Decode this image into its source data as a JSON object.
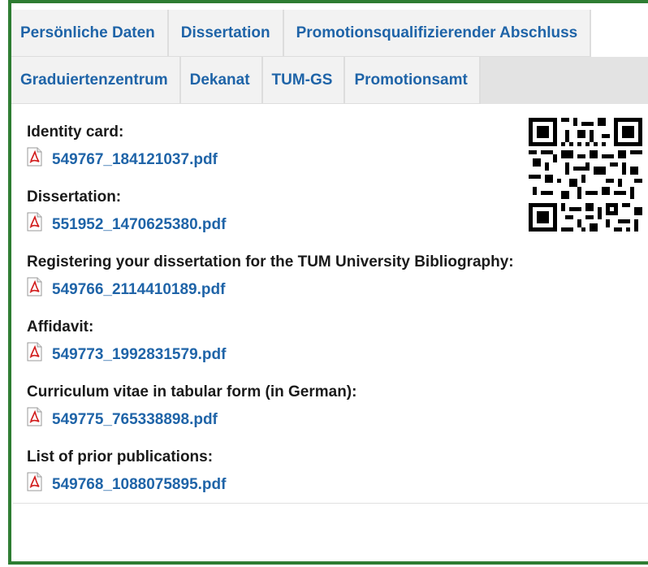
{
  "tabs": {
    "row1": [
      {
        "label": "Persönliche Daten"
      },
      {
        "label": "Dissertation"
      },
      {
        "label": "Promotionsqualifizierender Abschluss"
      }
    ],
    "row2": [
      {
        "label": "Graduiertenzentrum"
      },
      {
        "label": "Dekanat"
      },
      {
        "label": "TUM-GS"
      },
      {
        "label": "Promotionsamt"
      }
    ]
  },
  "documents": [
    {
      "label": "Identity card:",
      "file": "549767_184121037.pdf"
    },
    {
      "label": "Dissertation:",
      "file": "551952_1470625380.pdf"
    },
    {
      "label": "Registering your dissertation for the TUM University Bibliography:",
      "file": "549766_2114410189.pdf"
    },
    {
      "label": "Affidavit:",
      "file": "549773_1992831579.pdf"
    },
    {
      "label": "Curriculum vitae in tabular form (in German):",
      "file": "549775_765338898.pdf"
    },
    {
      "label": "List of prior publications:",
      "file": "549768_1088075895.pdf"
    }
  ],
  "icons": {
    "file": "pdf-file-icon",
    "code": "qr-code-icon"
  },
  "colors": {
    "accent_border": "#2e7d32",
    "link": "#1f64a8"
  }
}
